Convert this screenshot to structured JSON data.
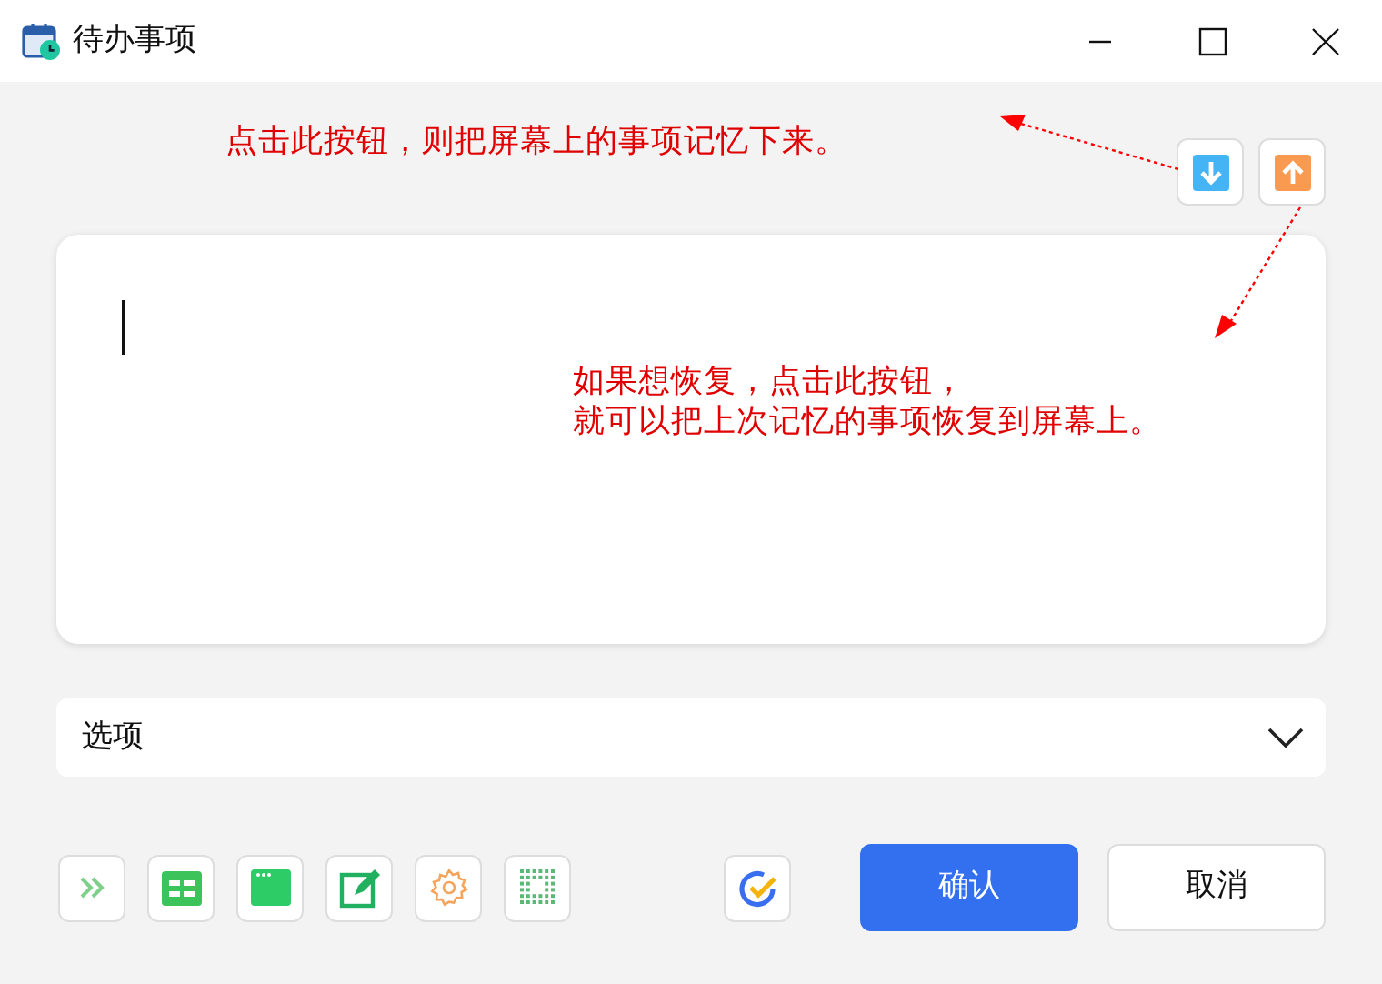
{
  "window": {
    "title": "待办事项"
  },
  "annotations": [
    {
      "lines": [
        "点击此按钮，则把屏幕上的事项记忆下来。"
      ]
    },
    {
      "lines": [
        "如果想恢复，点击此按钮，",
        "就可以把上次记忆的事项恢复到屏幕上。"
      ]
    }
  ],
  "options": {
    "value": "选项"
  },
  "buttons": [
    {
      "kind": "primary",
      "label": "确认"
    },
    {
      "kind": "secondary",
      "label": "取消"
    }
  ]
}
